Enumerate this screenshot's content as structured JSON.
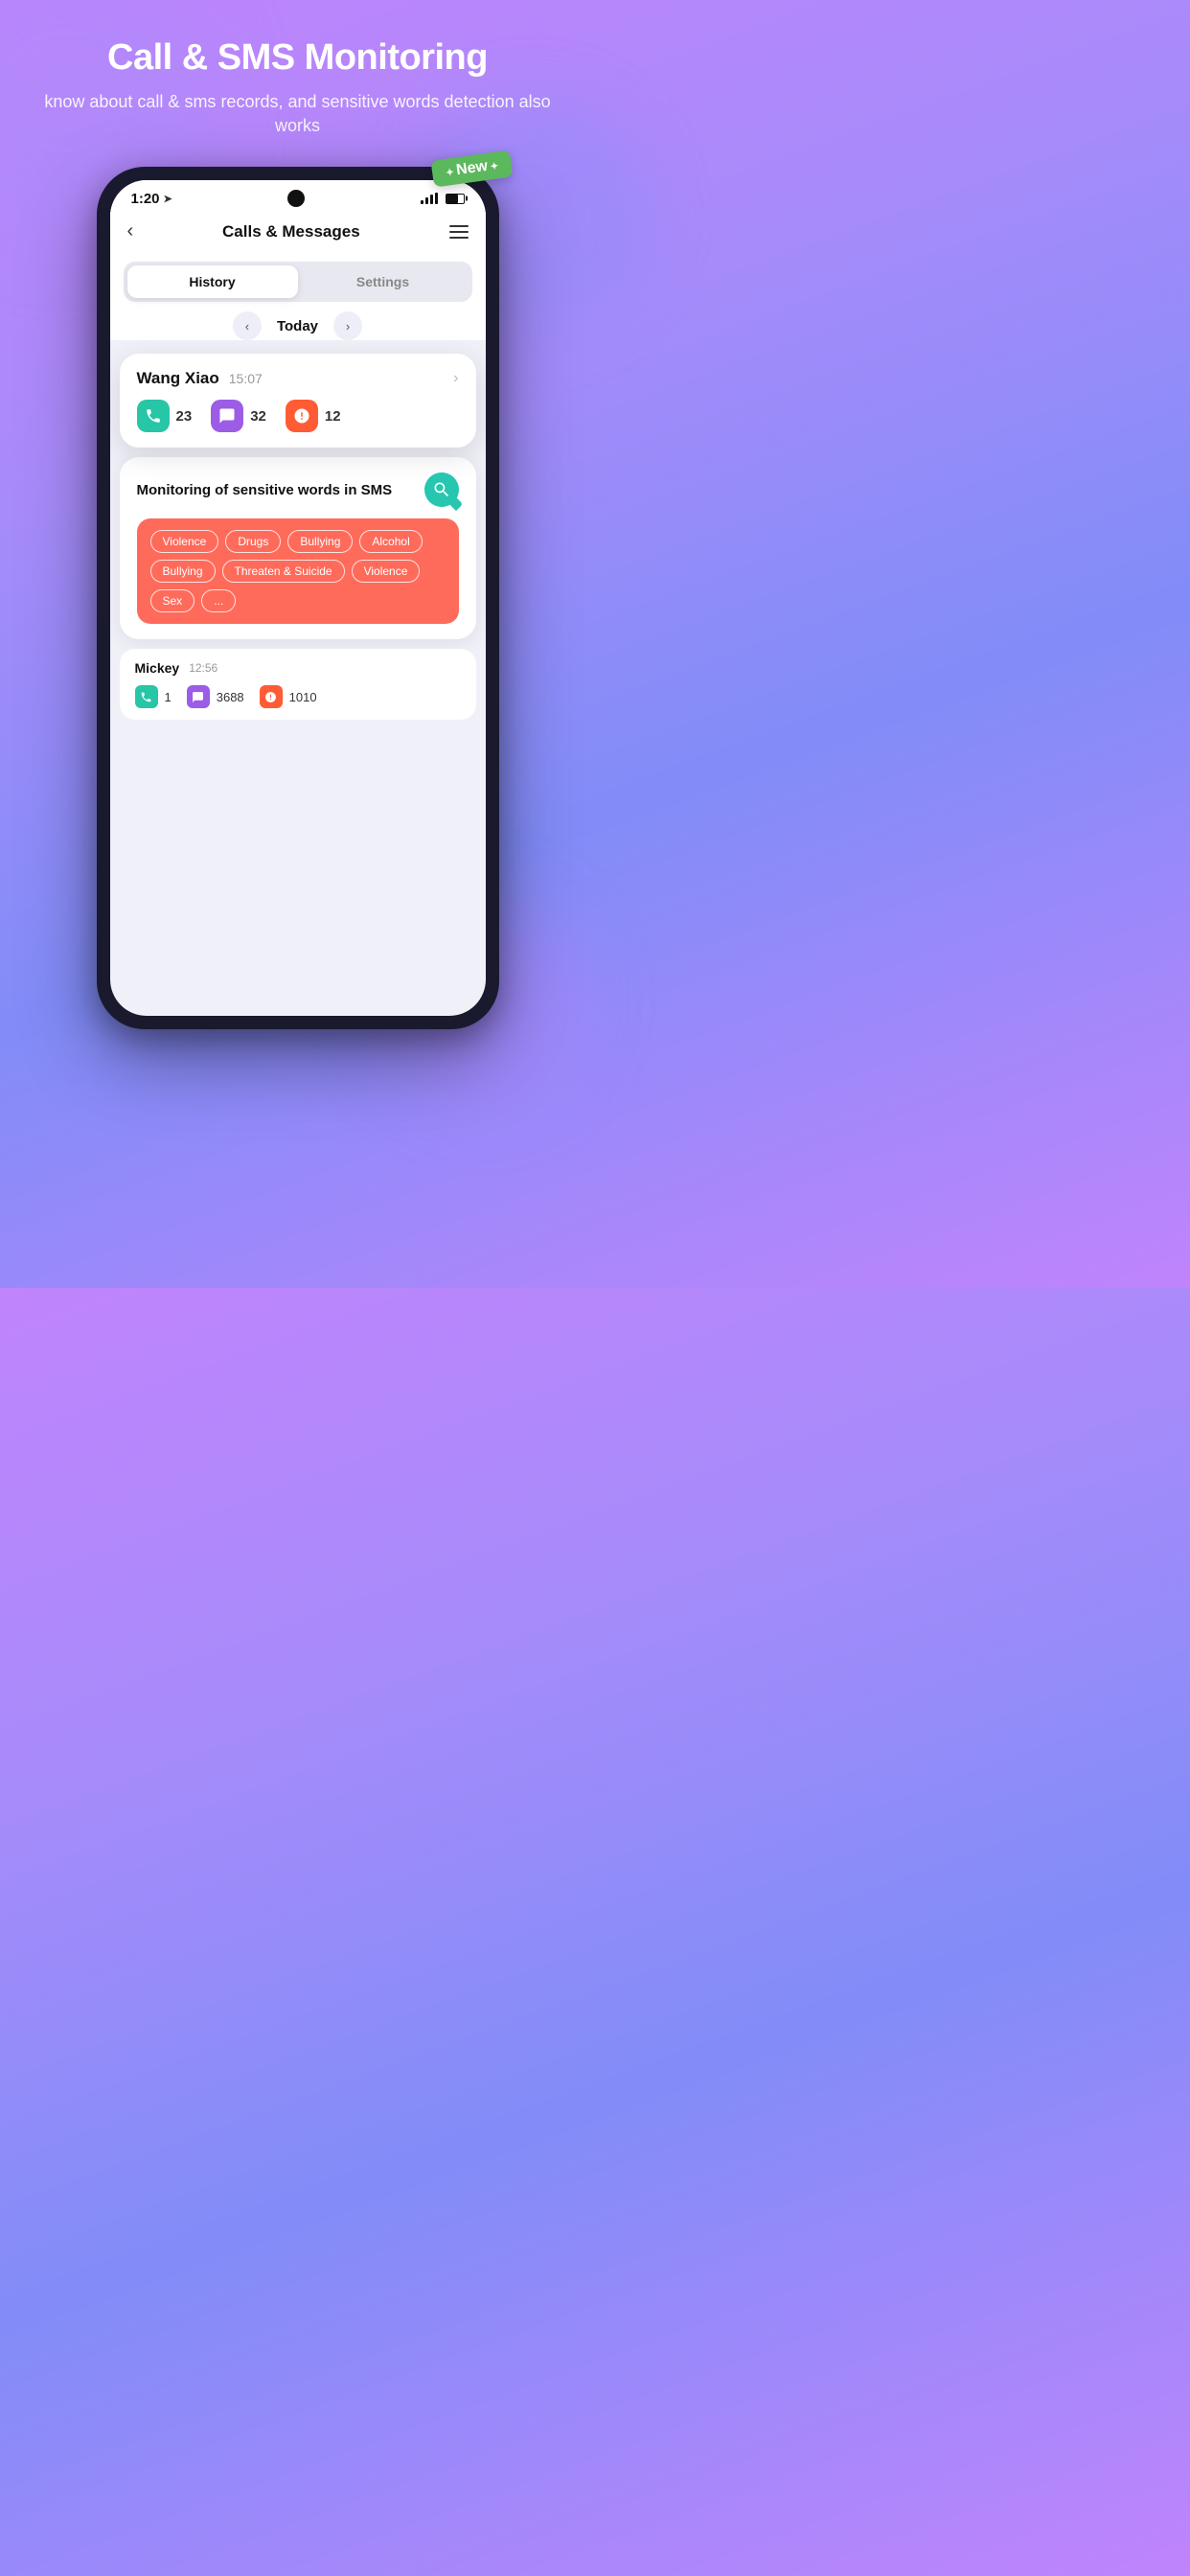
{
  "page": {
    "background": "purple-gradient",
    "main_title": "Call & SMS Monitoring",
    "sub_title": "know about call & sms records, and sensitive words detection also works"
  },
  "new_badge": "New",
  "status_bar": {
    "time": "1:20",
    "signal": true,
    "battery": true
  },
  "app_header": {
    "back_label": "‹",
    "title": "Calls & Messages",
    "menu_label": "≡"
  },
  "tabs": {
    "active": "History",
    "inactive": "Settings"
  },
  "date_nav": {
    "prev": "‹",
    "label": "Today",
    "next": "›"
  },
  "contact_wang": {
    "name": "Wang Xiao",
    "time": "15:07",
    "stats": [
      {
        "icon": "📞",
        "count": "23",
        "type": "call"
      },
      {
        "icon": "💬",
        "count": "32",
        "type": "message"
      },
      {
        "icon": "❗",
        "count": "12",
        "type": "alert"
      }
    ]
  },
  "sms_monitor": {
    "title": "Monitoring of sensitive words in SMS",
    "keywords": [
      "Violence",
      "Drugs",
      "Bullying",
      "Alcohol",
      "Bullying",
      "Threaten & Suicide",
      "Violence",
      "Sex",
      "..."
    ]
  },
  "contact_mickey": {
    "name": "Mickey",
    "time": "12:56",
    "stats": [
      {
        "count": "1",
        "type": "call"
      },
      {
        "count": "3688",
        "type": "message"
      },
      {
        "count": "1010",
        "type": "alert"
      }
    ]
  }
}
